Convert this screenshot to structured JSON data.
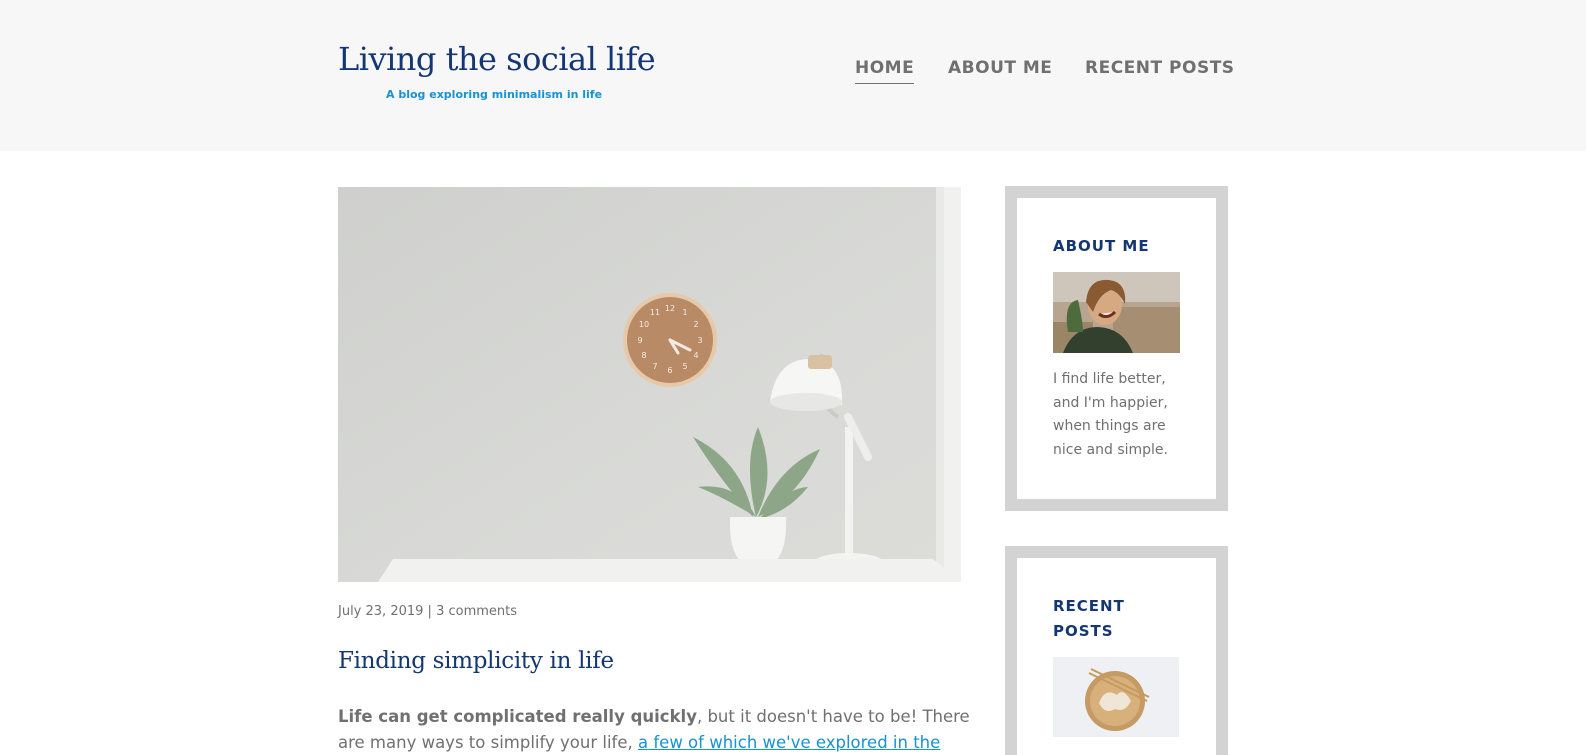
{
  "header": {
    "title": "Living the social life",
    "subtitle": "A blog exploring minimalism in life",
    "nav": [
      {
        "label": "HOME",
        "active": true
      },
      {
        "label": "ABOUT ME",
        "active": false
      },
      {
        "label": "RECENT POSTS",
        "active": false
      }
    ]
  },
  "post": {
    "date": "July 23, 2019",
    "separator": "|",
    "comments": "3 comments",
    "title": "Finding simplicity in life",
    "excerpt_bold": "Life can get complicated really quickly",
    "excerpt_text": ", but it doesn't have to be! There are many ways to simplify your life, ",
    "excerpt_link": "a few of which we've explored in the past"
  },
  "sidebar": {
    "about": {
      "title": "ABOUT ME",
      "text": "I find life better, and I'm happier, when things are nice and simple."
    },
    "recent": {
      "title": "RECENT POSTS"
    }
  },
  "colors": {
    "brand": "#143774",
    "accent": "#1792d2",
    "text": "#707070",
    "header_bg": "#f7f7f7",
    "widget_border": "#d3d3d3"
  }
}
